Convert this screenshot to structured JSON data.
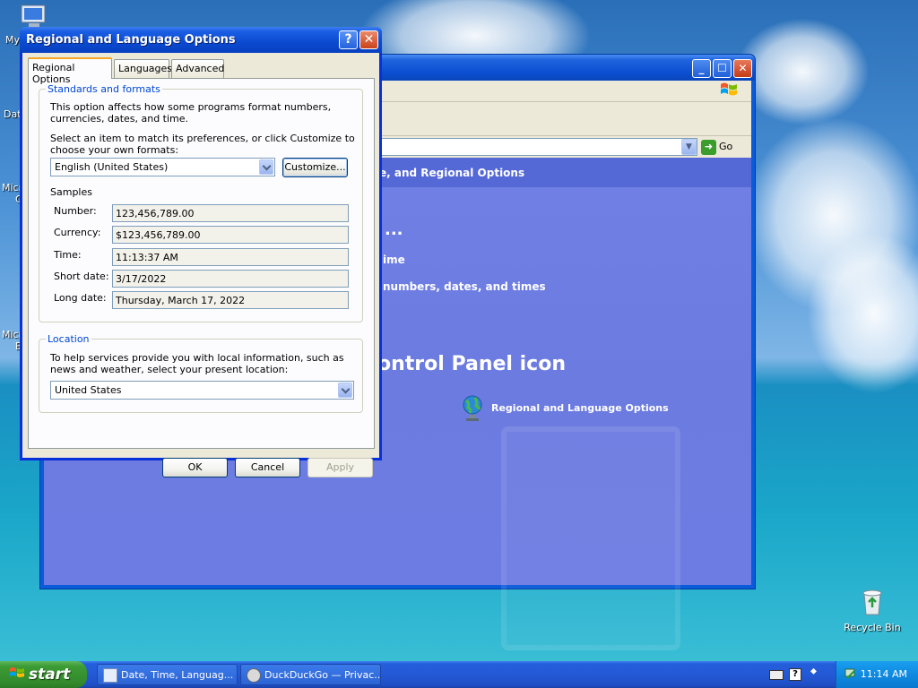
{
  "desktop": {
    "icons": [
      {
        "label": "My"
      },
      {
        "label": "Dat"
      },
      {
        "label": "Micro"
      },
      {
        "label": "C"
      },
      {
        "label": "Micro"
      },
      {
        "label": "B"
      }
    ],
    "recycle_bin": {
      "label": "Recycle Bin"
    }
  },
  "control_panel": {
    "go_label": "Go",
    "breadcrumb": "e, and Regional Options",
    "task_dots": "...",
    "task_1": "ime",
    "task_2": "numbers, dates, and times",
    "pick_text": "ontrol Panel icon",
    "link_regional": "Regional and Language Options"
  },
  "dialog": {
    "title": "Regional and Language Options",
    "help_glyph": "?",
    "close_glyph": "✕",
    "tabs": [
      {
        "label": "Regional Options",
        "active": true
      },
      {
        "label": "Languages"
      },
      {
        "label": "Advanced"
      }
    ],
    "standards": {
      "title": "Standards and formats",
      "desc": "This option affects how some programs format numbers, currencies, dates, and time.",
      "select_desc": "Select an item to match its preferences, or click Customize to choose your own formats:",
      "selected_format": "English (United States)",
      "customize_label": "Customize...",
      "samples_title": "Samples",
      "samples": [
        {
          "label": "Number:",
          "value": "123,456,789.00"
        },
        {
          "label": "Currency:",
          "value": "$123,456,789.00"
        },
        {
          "label": "Time:",
          "value": "11:13:37 AM"
        },
        {
          "label": "Short date:",
          "value": "3/17/2022"
        },
        {
          "label": "Long date:",
          "value": "Thursday, March 17, 2022"
        }
      ]
    },
    "location": {
      "title": "Location",
      "desc": "To help services provide you with local information, such as news and weather, select your present location:",
      "selected": "United States"
    },
    "buttons": {
      "ok": "OK",
      "cancel": "Cancel",
      "apply": "Apply"
    }
  },
  "taskbar": {
    "start_label": "start",
    "tasks": [
      {
        "label": "Date, Time, Languag..."
      },
      {
        "label": "DuckDuckGo — Privac..."
      }
    ],
    "clock": "11:14 AM"
  }
}
